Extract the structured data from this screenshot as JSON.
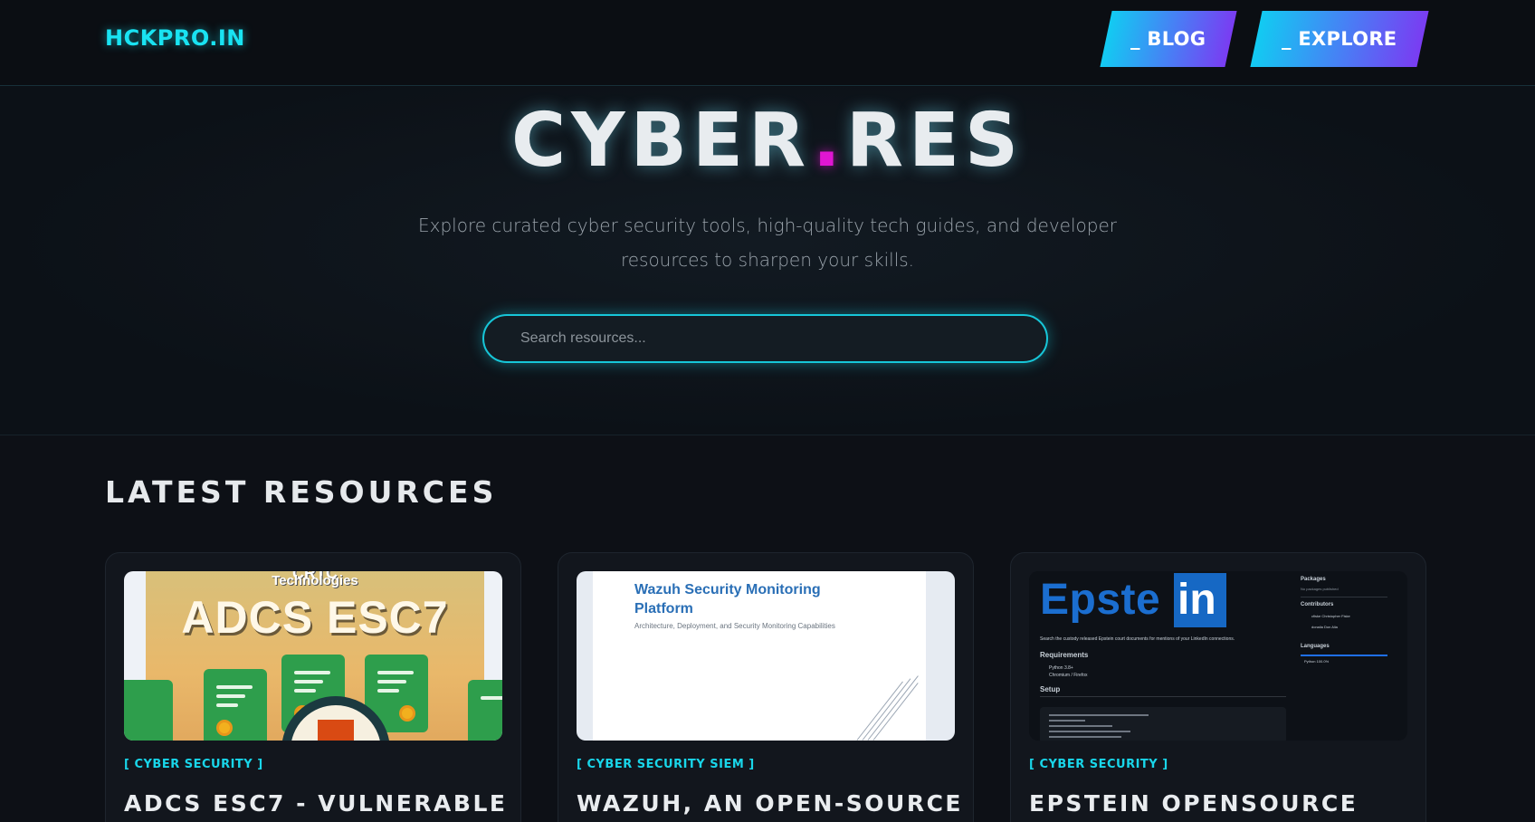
{
  "nav": {
    "logo": "HCKPRO.IN",
    "blog_label": "_ BLOG",
    "explore_label": "_ EXPLORE"
  },
  "hero": {
    "title_part1": "CYBER",
    "title_dot": ".",
    "title_part2": "RES",
    "subtitle": "Explore curated cyber security tools, high-quality tech guides, and developer resources to sharpen your skills.",
    "search_placeholder": "Search resources..."
  },
  "colors": {
    "accent": "#19e3f2",
    "magenta": "#e016d2",
    "button_gradient_start": "#12cbf2",
    "button_gradient_end": "#7a3cf2",
    "background": "#0d1016"
  },
  "latest": {
    "heading": "LATEST RESOURCES",
    "cards": [
      {
        "tag": "[ CYBER SECURITY ]",
        "title": "ADCS ESC7 - VULNERABLE",
        "thumb": {
          "brand": "CRTC",
          "brand_sub": "Technologies",
          "headline": "ADCS ESC7"
        }
      },
      {
        "tag": "[ CYBER SECURITY SIEM ]",
        "title": "WAZUH, AN OPEN-SOURCE",
        "thumb": {
          "headline": "Wazuh Security Monitoring Platform",
          "subhead": "Architecture, Deployment, and Security Monitoring Capabilities"
        }
      },
      {
        "tag": "[ CYBER SECURITY ]",
        "title": "EPSTEIN OPENSOURCE",
        "thumb": {
          "word": "Epste",
          "word_box": "in",
          "readme_line": "Search the custody released Epstein court documents for mentions of your LinkedIn connections.",
          "requirements": "Requirements",
          "req_items": [
            "Python 3.8+",
            "Chromium / Firefox"
          ],
          "setup": "Setup",
          "side_packages": "Packages",
          "side_packages_note": "No packages published",
          "side_contributors": "Contributors",
          "contributors": [
            "cfiske Christopher Fiske",
            "donalia Don Alia"
          ],
          "side_languages": "Languages",
          "language": "Python 100.0%"
        }
      }
    ]
  }
}
